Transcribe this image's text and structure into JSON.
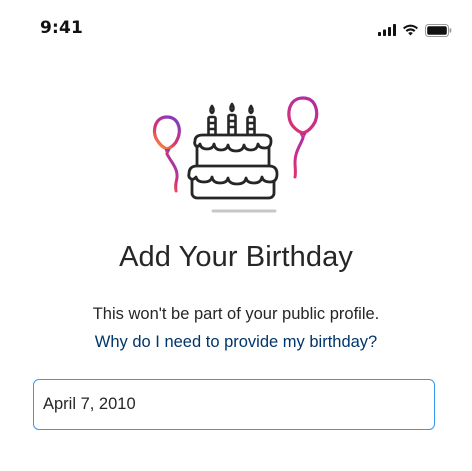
{
  "status_bar": {
    "time": "9:41",
    "icons": [
      "cellular-signal-icon",
      "wifi-icon",
      "battery-icon"
    ]
  },
  "illustration": {
    "name": "birthday-cake-with-balloons",
    "balloon_gradient": [
      "#f9a334",
      "#e1306c",
      "#8a3ab9"
    ],
    "line_color": "#262626",
    "shadow_color": "#c7c7c7"
  },
  "content": {
    "title": "Add Your Birthday",
    "subtitle": "This won't be part of your public profile.",
    "link": "Why do I need to provide my birthday?"
  },
  "birthday_input": {
    "value": "April 7, 2010"
  },
  "colors": {
    "link": "#003569",
    "input_border": "#3897f0",
    "text": "#262626"
  }
}
